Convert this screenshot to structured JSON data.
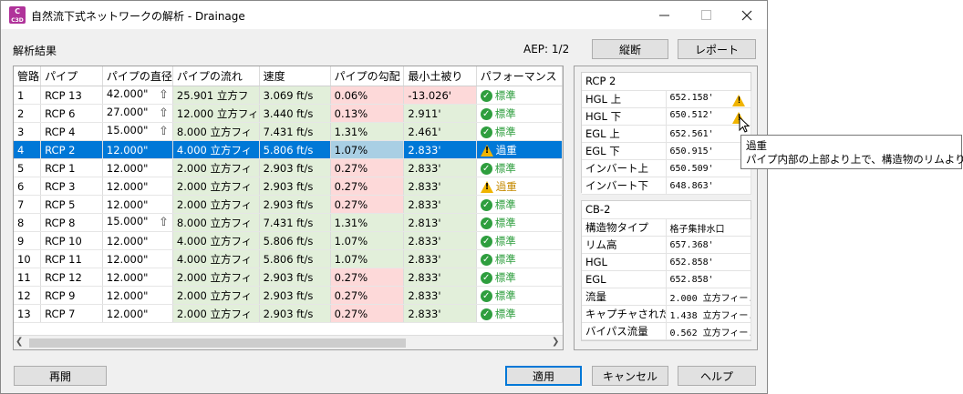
{
  "window": {
    "app_icon_text": "C",
    "app_icon_sub": "C3D",
    "title": "自然流下式ネットワークの解析 - Drainage",
    "minimize_icon": "minimize-icon",
    "maximize_icon": "maximize-icon",
    "close_icon": "close-icon"
  },
  "header": {
    "section_label": "解析結果",
    "aep_label": "AEP: 1/2",
    "profile_button": "縦断",
    "report_button": "レポート"
  },
  "grid": {
    "columns": [
      "管路",
      "パイプ",
      "パイプの直径",
      "パイプの流れ",
      "速度",
      "パイプの勾配",
      "最小土被り",
      "パフォーマンス"
    ],
    "rows": [
      {
        "no": "1",
        "pipe": "RCP 13",
        "dia": "42.000\"",
        "up": true,
        "flow": "25.901 立方フ",
        "speed": "3.069 ft/s",
        "slope": "0.06%",
        "slope_status": "bad",
        "cover": "-13.026'",
        "cover_status": "bad",
        "perf": "標準",
        "perf_status": "ok"
      },
      {
        "no": "2",
        "pipe": "RCP 6",
        "dia": "27.000\"",
        "up": true,
        "flow": "12.000 立方フィ",
        "speed": "3.440 ft/s",
        "slope": "0.13%",
        "slope_status": "bad",
        "cover": "2.911'",
        "cover_status": "good",
        "perf": "標準",
        "perf_status": "ok"
      },
      {
        "no": "3",
        "pipe": "RCP 4",
        "dia": "15.000\"",
        "up": true,
        "flow": "8.000 立方フィ",
        "speed": "7.431 ft/s",
        "slope": "1.31%",
        "slope_status": "good",
        "cover": "2.461'",
        "cover_status": "good",
        "perf": "標準",
        "perf_status": "ok"
      },
      {
        "no": "4",
        "pipe": "RCP 2",
        "dia": "12.000\"",
        "up": false,
        "flow": "4.000 立方フィ",
        "speed": "5.806 ft/s",
        "slope": "1.07%",
        "slope_status": "good",
        "cover": "2.833'",
        "cover_status": "good",
        "perf": "過重",
        "perf_status": "warn",
        "selected": true
      },
      {
        "no": "5",
        "pipe": "RCP 1",
        "dia": "12.000\"",
        "up": false,
        "flow": "2.000 立方フィ",
        "speed": "2.903 ft/s",
        "slope": "0.27%",
        "slope_status": "bad",
        "cover": "2.833'",
        "cover_status": "good",
        "perf": "標準",
        "perf_status": "ok"
      },
      {
        "no": "6",
        "pipe": "RCP 3",
        "dia": "12.000\"",
        "up": false,
        "flow": "2.000 立方フィ",
        "speed": "2.903 ft/s",
        "slope": "0.27%",
        "slope_status": "bad",
        "cover": "2.833'",
        "cover_status": "good",
        "perf": "過重",
        "perf_status": "warn"
      },
      {
        "no": "7",
        "pipe": "RCP 5",
        "dia": "12.000\"",
        "up": false,
        "flow": "2.000 立方フィ",
        "speed": "2.903 ft/s",
        "slope": "0.27%",
        "slope_status": "bad",
        "cover": "2.833'",
        "cover_status": "good",
        "perf": "標準",
        "perf_status": "ok"
      },
      {
        "no": "8",
        "pipe": "RCP 8",
        "dia": "15.000\"",
        "up": true,
        "flow": "8.000 立方フィ",
        "speed": "7.431 ft/s",
        "slope": "1.31%",
        "slope_status": "good",
        "cover": "2.813'",
        "cover_status": "good",
        "perf": "標準",
        "perf_status": "ok"
      },
      {
        "no": "9",
        "pipe": "RCP 10",
        "dia": "12.000\"",
        "up": false,
        "flow": "4.000 立方フィ",
        "speed": "5.806 ft/s",
        "slope": "1.07%",
        "slope_status": "good",
        "cover": "2.833'",
        "cover_status": "good",
        "perf": "標準",
        "perf_status": "ok"
      },
      {
        "no": "10",
        "pipe": "RCP 11",
        "dia": "12.000\"",
        "up": false,
        "flow": "4.000 立方フィ",
        "speed": "5.806 ft/s",
        "slope": "1.07%",
        "slope_status": "good",
        "cover": "2.833'",
        "cover_status": "good",
        "perf": "標準",
        "perf_status": "ok"
      },
      {
        "no": "11",
        "pipe": "RCP 12",
        "dia": "12.000\"",
        "up": false,
        "flow": "2.000 立方フィ",
        "speed": "2.903 ft/s",
        "slope": "0.27%",
        "slope_status": "bad",
        "cover": "2.833'",
        "cover_status": "good",
        "perf": "標準",
        "perf_status": "ok"
      },
      {
        "no": "12",
        "pipe": "RCP 9",
        "dia": "12.000\"",
        "up": false,
        "flow": "2.000 立方フィ",
        "speed": "2.903 ft/s",
        "slope": "0.27%",
        "slope_status": "bad",
        "cover": "2.833'",
        "cover_status": "good",
        "perf": "標準",
        "perf_status": "ok"
      },
      {
        "no": "13",
        "pipe": "RCP 7",
        "dia": "12.000\"",
        "up": false,
        "flow": "2.000 立方フィ",
        "speed": "2.903 ft/s",
        "slope": "0.27%",
        "slope_status": "bad",
        "cover": "2.833'",
        "cover_status": "good",
        "perf": "標準",
        "perf_status": "ok"
      }
    ]
  },
  "pipe_panel": {
    "title": "RCP 2",
    "rows": [
      {
        "label": "HGL 上",
        "value": "652.158'",
        "warn": true
      },
      {
        "label": "HGL 下",
        "value": "650.512'",
        "warn": true
      },
      {
        "label": "EGL 上",
        "value": "652.561'",
        "warn": false
      },
      {
        "label": "EGL 下",
        "value": "650.915'",
        "warn": false
      },
      {
        "label": "インバート上",
        "value": "650.509'",
        "warn": false
      },
      {
        "label": "インバート下",
        "value": "648.863'",
        "warn": false
      }
    ]
  },
  "structure_panel": {
    "title": "CB-2",
    "rows": [
      {
        "label": "構造物タイプ",
        "value": "格子集排水口"
      },
      {
        "label": "リム高",
        "value": "657.368'"
      },
      {
        "label": "HGL",
        "value": "652.858'"
      },
      {
        "label": "EGL",
        "value": "652.858'"
      },
      {
        "label": "流量",
        "value": "2.000 立方フィー..."
      },
      {
        "label": "キャプチャされた...",
        "value": "1.438 立方フィー..."
      },
      {
        "label": "バイパス流量",
        "value": "0.562 立方フィー..."
      }
    ]
  },
  "tooltip": {
    "title": "過重",
    "text": "パイプ内部の上部より上で、構造物のリムより下。"
  },
  "footer": {
    "reopen_button": "再開",
    "apply_button": "適用",
    "cancel_button": "キャンセル",
    "help_button": "ヘルプ"
  },
  "colors": {
    "selection": "#0078d7",
    "good_cell": "#e2efda",
    "bad_cell": "#fdd9d9",
    "ok_status": "#2e9e3e",
    "warn_status": "#f0b400",
    "app_icon": "#b0339a"
  }
}
